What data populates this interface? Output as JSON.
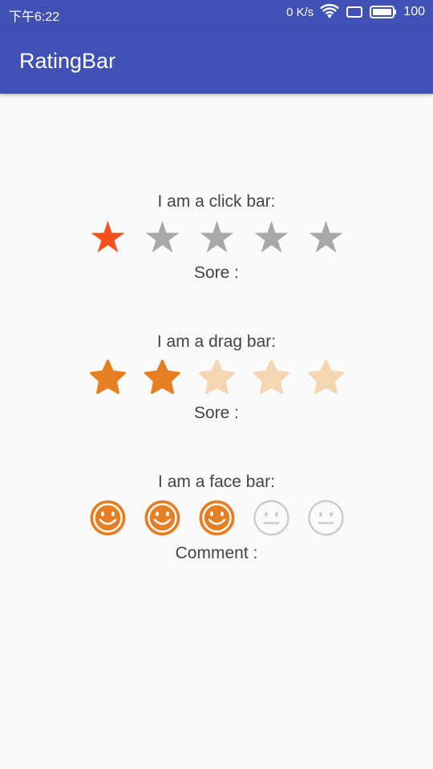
{
  "status_bar": {
    "time": "下午6:22",
    "net_speed": "0 K/s",
    "battery": "100",
    "icons": [
      "wifi-icon",
      "sim-icon",
      "battery-icon"
    ]
  },
  "app_bar": {
    "title": "RatingBar"
  },
  "colors": {
    "primary": "#3f51b5",
    "click_star_on": "#f4511e",
    "star_off": "#a8a8a8",
    "drag_star_on": "#e67e22",
    "drag_star_off": "#f5d6b3",
    "face_on": "#e67e22",
    "face_off": "#cccccc"
  },
  "click_bar": {
    "label": "I am a click bar:",
    "rating": 1,
    "max": 5,
    "result": "Sore :"
  },
  "drag_bar": {
    "label": "I am a drag bar:",
    "rating": 2,
    "max": 5,
    "result": "Sore :"
  },
  "face_bar": {
    "label": "I am a face bar:",
    "rating": 3,
    "max": 5,
    "result": "Comment :"
  }
}
